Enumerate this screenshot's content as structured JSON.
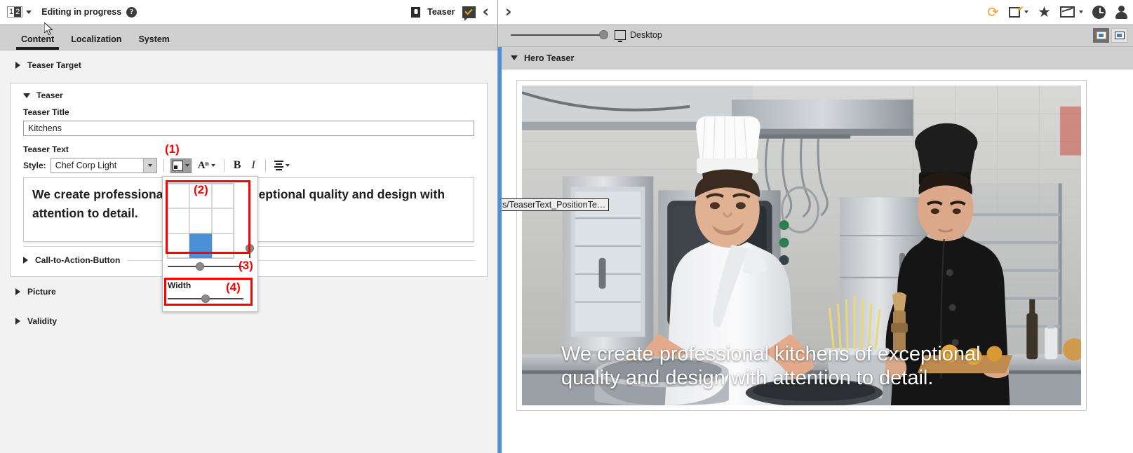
{
  "left": {
    "header": {
      "version_current": "1",
      "version_selected": "2",
      "status": "Editing in progress",
      "help_icon": "help-icon",
      "doc_icon": "document-icon",
      "doc_label": "Teaser",
      "approval_icon": "approval-balloon-icon",
      "prev_icon": "‹",
      "next_icon": "›"
    },
    "tabs": [
      {
        "label": "Content",
        "active": true
      },
      {
        "label": "Localization",
        "active": false
      },
      {
        "label": "System",
        "active": false
      }
    ],
    "sections": {
      "teaser_target": "Teaser Target",
      "teaser": "Teaser",
      "picture": "Picture",
      "validity": "Validity",
      "cta": "Call-to-Action-Button"
    },
    "fields": {
      "title_label": "Teaser Title",
      "title_value": "Kitchens",
      "title_placeholder": "",
      "text_label": "Teaser Text",
      "style_label": "Style:",
      "style_value": "Chef Corp Light",
      "rte_text": "We create professional kitchens of exceptional quality and design with attention to detail."
    },
    "toolbar_icons": {
      "position": "text-position-icon",
      "font_size": "font-size-icon",
      "bold": "B",
      "italic": "I",
      "align": "align-icon"
    },
    "popup": {
      "grid_cells": [
        {
          "id": "top-left",
          "selected": false
        },
        {
          "id": "top-center",
          "selected": false
        },
        {
          "id": "top-right",
          "selected": false
        },
        {
          "id": "middle-left",
          "selected": false
        },
        {
          "id": "middle-center",
          "selected": false
        },
        {
          "id": "middle-right",
          "selected": false
        },
        {
          "id": "bottom-left",
          "selected": false
        },
        {
          "id": "bottom-center",
          "selected": true
        },
        {
          "id": "bottom-right",
          "selected": false
        }
      ],
      "vertical_offset_pct": 92,
      "horizontal_offset_pct": 42,
      "width_label": "Width",
      "width_pct": 50
    },
    "annotations": [
      {
        "id": "1",
        "label": "(1)"
      },
      {
        "id": "2",
        "label": "(2)"
      },
      {
        "id": "3",
        "label": "(3)"
      },
      {
        "id": "4",
        "label": "(4)"
      }
    ]
  },
  "right": {
    "header_icons": {
      "next": "›",
      "refresh": "refresh-icon",
      "open_external": "open-external-icon",
      "bookmark": "★",
      "media": "media-icon",
      "history": "clock-icon",
      "user": "user-avatar-icon"
    },
    "toolbar": {
      "zoom_pct": 100,
      "device_icon": "monitor-icon",
      "device_label": "Desktop",
      "view_split": "split-view-button",
      "view_full": "full-view-button"
    },
    "section_label": "Hero Teaser",
    "tooltip": "s/TeaserText_PositionTe…",
    "hero_text": "We create professional kitchens of exceptional quality and design with attention to detail."
  },
  "colors": {
    "accent_blue": "#4a90d9",
    "annotation_red": "#ff0000",
    "orange": "#f0a02a",
    "toolbar_gray": "#d0d0d0"
  }
}
